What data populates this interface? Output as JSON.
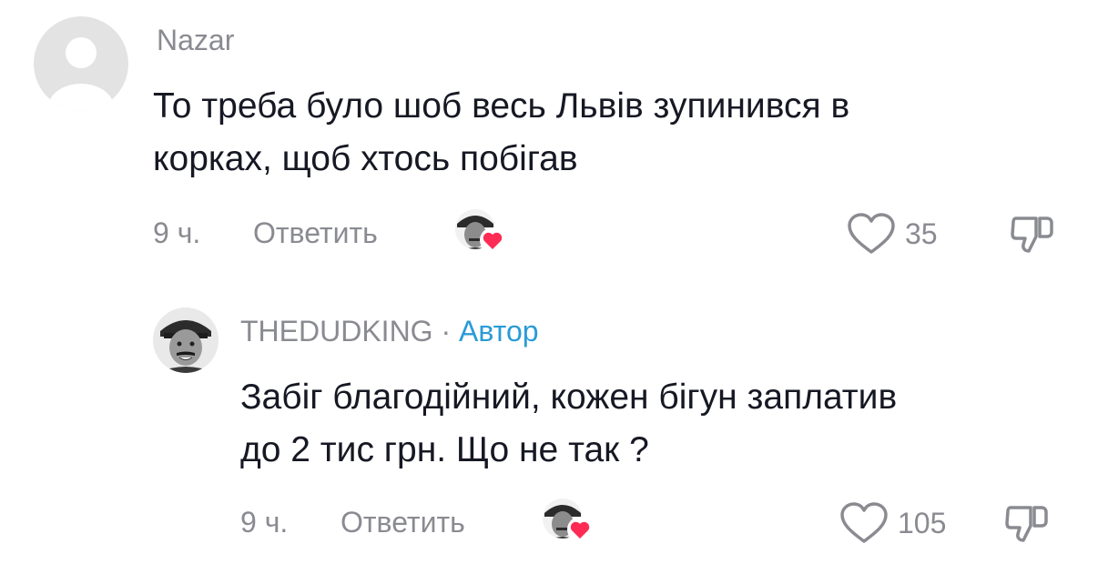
{
  "comments": [
    {
      "author": "Nazar",
      "badge_separator": "",
      "badge": "",
      "text_lines": [
        "То треба було шоб весь Львів зупинився в",
        "корках, щоб хтось побігав"
      ],
      "time": "9 ч.",
      "reply_label": "Ответить",
      "likes": "35",
      "liked_by_creator": true
    },
    {
      "author": "THEDUDKING",
      "badge_separator": " · ",
      "badge": "Автор",
      "text_lines": [
        "Забіг благодійний, кожен бігун заплатив",
        "до 2 тис грн. Що не так ?"
      ],
      "time": "9 ч.",
      "reply_label": "Ответить",
      "likes": "105",
      "liked_by_creator": true
    }
  ],
  "colors": {
    "text": "#161823",
    "muted": "#8a8b91",
    "author_badge": "#2a9bd6",
    "heart_red": "#fe2c55",
    "default_avatar_bg": "#e3e3e4"
  },
  "icons": {
    "like": "heart-outline-icon",
    "dislike": "thumbs-down-outline-icon",
    "creator_like": "creator-heart-badge-icon",
    "default_avatar": "default-user-avatar-icon"
  }
}
